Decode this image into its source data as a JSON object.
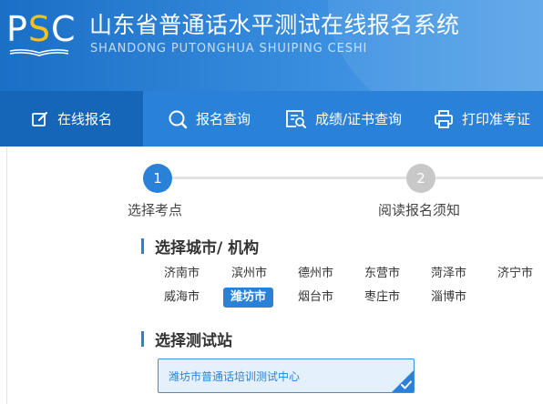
{
  "header": {
    "logo_text_p": "P",
    "logo_text_s": "S",
    "logo_text_c": "C",
    "title": "山东省普通话水平测试在线报名系统",
    "subtitle": "SHANDONG PUTONGHUA SHUIPING CESHI"
  },
  "nav": {
    "items": [
      {
        "label": "在线报名",
        "icon": "edit-icon",
        "active": true
      },
      {
        "label": "报名查询",
        "icon": "search-icon",
        "active": false
      },
      {
        "label": "成绩/证书查询",
        "icon": "certificate-search-icon",
        "active": false
      },
      {
        "label": "打印准考证",
        "icon": "printer-icon",
        "active": false
      }
    ]
  },
  "steps": [
    {
      "number": "1",
      "label": "选择考点",
      "state": "active"
    },
    {
      "number": "2",
      "label": "阅读报名须知",
      "state": "pending"
    }
  ],
  "city_section": {
    "title": "选择城市/ 机构",
    "cities": [
      "济南市",
      "滨州市",
      "德州市",
      "东营市",
      "菏泽市",
      "济宁市",
      "威海市",
      "潍坊市",
      "烟台市",
      "枣庄市",
      "淄博市"
    ],
    "selected": "潍坊市"
  },
  "station_section": {
    "title": "选择测试站",
    "stations": [
      {
        "label": "潍坊市普通话培训测试中心",
        "selected": true
      }
    ]
  },
  "colors": {
    "primary": "#2a82d8",
    "nav_active": "#1565b8",
    "logo_accent": "#f5c020",
    "step_active": "#2a82d8",
    "step_pending": "#c8c8c8",
    "station_bg": "#e4f1fc"
  }
}
